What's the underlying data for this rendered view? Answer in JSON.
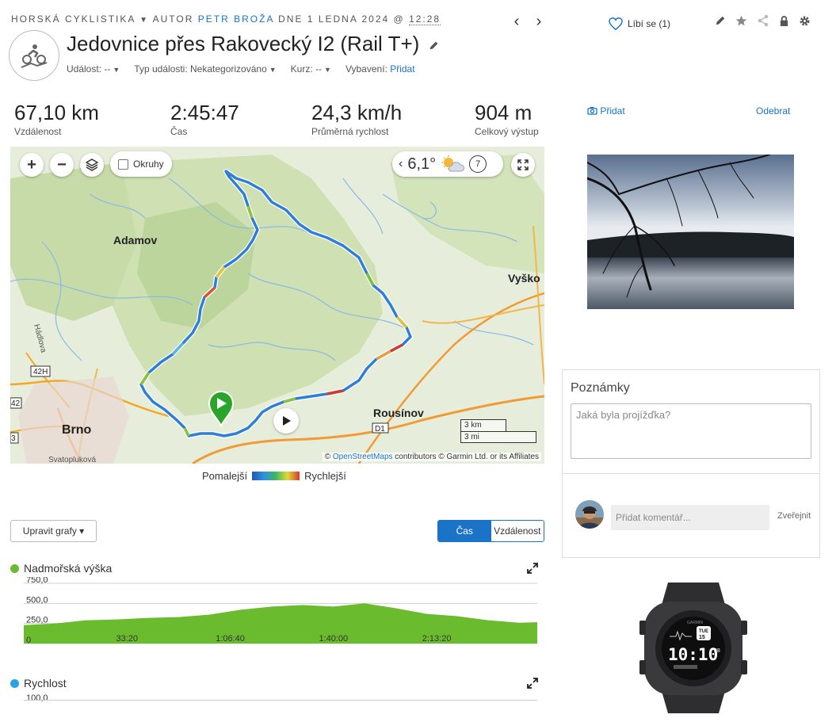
{
  "header": {
    "activity_type": "HORSKÁ CYKLISTIKA",
    "author_prefix": "AUTOR",
    "author": "PETR BROŽA",
    "date_text": "DNE 1 LEDNA 2024 @",
    "time": "12:28",
    "title": "Jedovnice přes Rakovecký I2 (Rail T+)",
    "like_label": "Líbí se (1)"
  },
  "meta": {
    "event_label": "Událost:",
    "event_value": "--",
    "event_type_label": "Typ události:",
    "event_type_value": "Nekategorizováno",
    "course_label": "Kurz:",
    "course_value": "--",
    "gear_label": "Vybavení:",
    "gear_link": "Přidat"
  },
  "stats": [
    {
      "value": "67,10 km",
      "label": "Vzdálenost"
    },
    {
      "value": "2:45:47",
      "label": "Čas"
    },
    {
      "value": "24,3 km/h",
      "label": "Průměrná rychlost"
    },
    {
      "value": "904 m",
      "label": "Celkový výstup"
    }
  ],
  "map": {
    "okruhy_label": "Okruhy",
    "temperature": "6,1°",
    "wind": "7",
    "places": {
      "adamov": "Adamov",
      "vyskov": "Vyško",
      "rousinov": "Rousínov",
      "brno": "Brno",
      "svatoplukova": "Svatopluková",
      "hadlova": "Hádlova",
      "highway": "D1",
      "road_42h": "42H",
      "road_42": "42",
      "road_3": "3"
    },
    "scale_km": "3 km",
    "scale_mi": "3 mi",
    "attribution_prefix": "©",
    "attribution_link": "OpenStreetMaps",
    "attribution_rest": "contributors © Garmin Ltd. or its Affiliates"
  },
  "speed_legend": {
    "slow": "Pomalejší",
    "fast": "Rychlejší"
  },
  "charts_toolbar": {
    "edit_label": "Upravit grafy ▾",
    "tab_time": "Čas",
    "tab_distance": "Vzdálenost"
  },
  "chart_data": [
    {
      "type": "area",
      "title": "Nadmořská výška",
      "y_ticks": [
        "750,0",
        "500,0",
        "250,0",
        "0"
      ],
      "x_ticks": [
        "33:20",
        "1:06:40",
        "1:40:00",
        "2:13:20"
      ],
      "ylim": [
        0,
        750
      ],
      "x_minutes": [
        0,
        10,
        20,
        30,
        40,
        50,
        60,
        70,
        80,
        90,
        100,
        110,
        120,
        130,
        140,
        150,
        160,
        165.8
      ],
      "values": [
        230,
        250,
        290,
        300,
        320,
        330,
        360,
        420,
        460,
        480,
        460,
        500,
        440,
        370,
        340,
        290,
        260,
        265
      ],
      "color": "#6bbb2f"
    },
    {
      "type": "line",
      "title": "Rychlost",
      "y_ticks": [
        "100,0"
      ],
      "color": "#27a4e8"
    }
  ],
  "sidebar": {
    "add_photo": "Přidat",
    "remove_photo": "Odebrat",
    "notes_title": "Poznámky",
    "notes_placeholder": "Jaká byla projížďka?",
    "comment_placeholder": "Přidat komentář...",
    "post_label": "Zveřejnit"
  },
  "watch": {
    "time": "10:10",
    "seconds": "38",
    "day": "TUE",
    "date": "15",
    "brand": "GARMIN"
  },
  "colors": {
    "accent": "#1a73c7",
    "start_marker": "#2aa52a"
  }
}
